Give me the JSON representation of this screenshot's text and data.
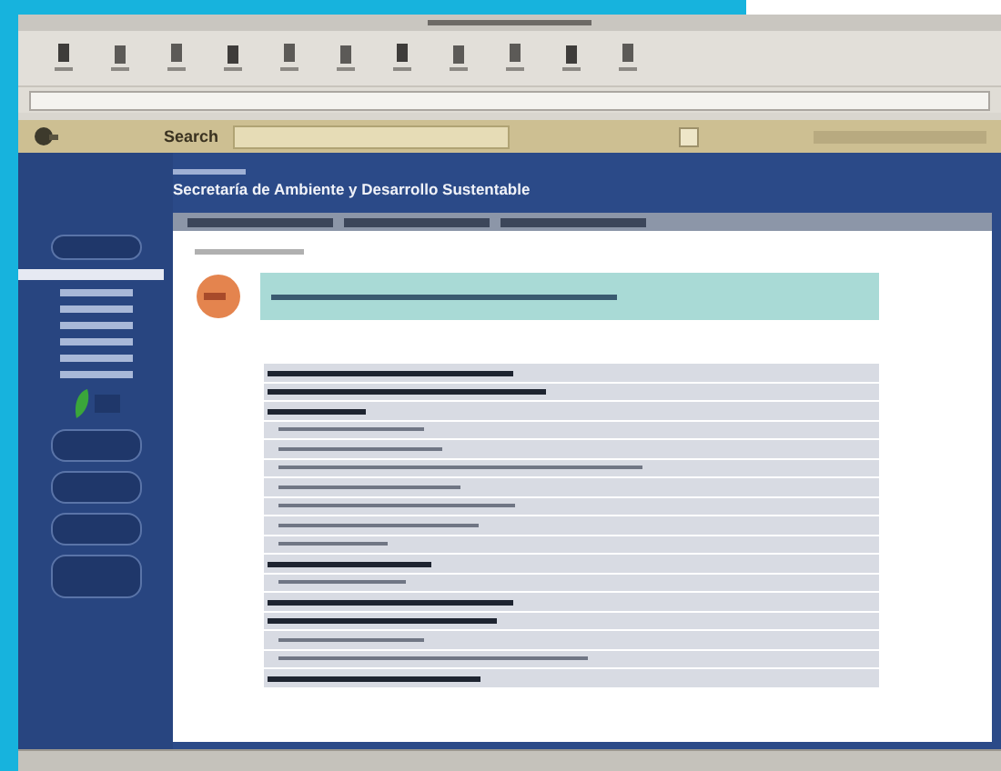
{
  "search_bar": {
    "label": "Search"
  },
  "header": {
    "title": "Secretaría de Ambiente y Desarrollo Sustentable"
  },
  "list": {
    "rows": [
      {
        "kind": "heading"
      },
      {
        "kind": "heading"
      },
      {
        "kind": "heading"
      },
      {
        "kind": "item"
      },
      {
        "kind": "item"
      },
      {
        "kind": "item"
      },
      {
        "kind": "item"
      },
      {
        "kind": "item"
      },
      {
        "kind": "item"
      },
      {
        "kind": "item"
      },
      {
        "kind": "heading"
      },
      {
        "kind": "item"
      },
      {
        "kind": "heading"
      },
      {
        "kind": "heading"
      },
      {
        "kind": "item"
      },
      {
        "kind": "item"
      },
      {
        "kind": "heading"
      }
    ]
  }
}
